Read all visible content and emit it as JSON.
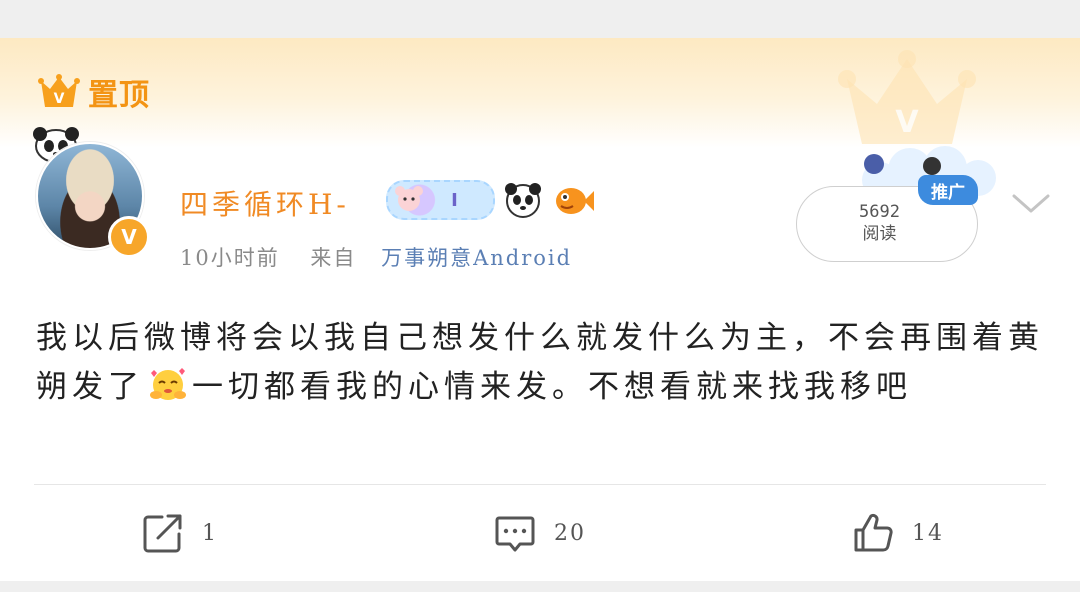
{
  "pin": {
    "label": "置顶",
    "icon": "v-crown-icon"
  },
  "user": {
    "name": "四季循环H-",
    "verified_badge": "V",
    "badge_tag_text": "I"
  },
  "meta": {
    "time": "10小时前",
    "from_label": "来自",
    "source": "万事朔意Android"
  },
  "promo": {
    "reads_count": "5692",
    "reads_label": "阅读",
    "tag": "推广"
  },
  "post": {
    "text_before_emoji": "我以后微博将会以我自己想发什么就发什么为主，不会再围着黄朔发了",
    "text_after_emoji": "一切都看我的心情来发。不想看就来找我移吧",
    "emoji": "hug-emoji"
  },
  "actions": {
    "repost_count": "1",
    "comment_count": "20",
    "like_count": "14"
  },
  "colors": {
    "accent_orange": "#f39414",
    "username": "#f08a24",
    "source_link": "#5b7fb4",
    "promo_blue": "#3d8bde"
  }
}
